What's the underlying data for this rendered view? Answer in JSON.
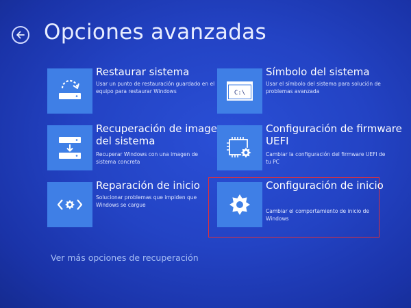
{
  "page": {
    "title": "Opciones avanzadas",
    "more_options_link": "Ver más opciones de recuperación"
  },
  "tiles": [
    {
      "title": "Restaurar sistema",
      "description": "Usar un punto de restauración guardado en el equipo para restaurar Windows",
      "icon": "restore-icon"
    },
    {
      "title": "Símbolo del sistema",
      "description": "Usar el símbolo del sistema para solución de problemas avanzada",
      "icon": "command-prompt-icon",
      "icon_text": "C:\\"
    },
    {
      "title": "Recuperación de imagen del sistema",
      "description": "Recuperar Windows con una imagen de sistema concreta",
      "icon": "system-image-icon"
    },
    {
      "title": "Configuración de firmware UEFI",
      "description": "Cambiar la configuración del firmware UEFI de tu PC",
      "icon": "firmware-chip-gear-icon"
    },
    {
      "title": "Reparación de inicio",
      "description": "Solucionar problemas que impiden que Windows se cargue",
      "icon": "startup-repair-icon"
    },
    {
      "title": "Configuración de inicio",
      "description": "Cambiar el comportamiento de inicio de Windows",
      "icon": "gear-icon",
      "highlighted": true
    }
  ],
  "colors": {
    "background": "#2343c4",
    "tile_icon_bg": "#3f7fe6",
    "highlight_border": "#e0303a",
    "link": "#a8bff5"
  }
}
